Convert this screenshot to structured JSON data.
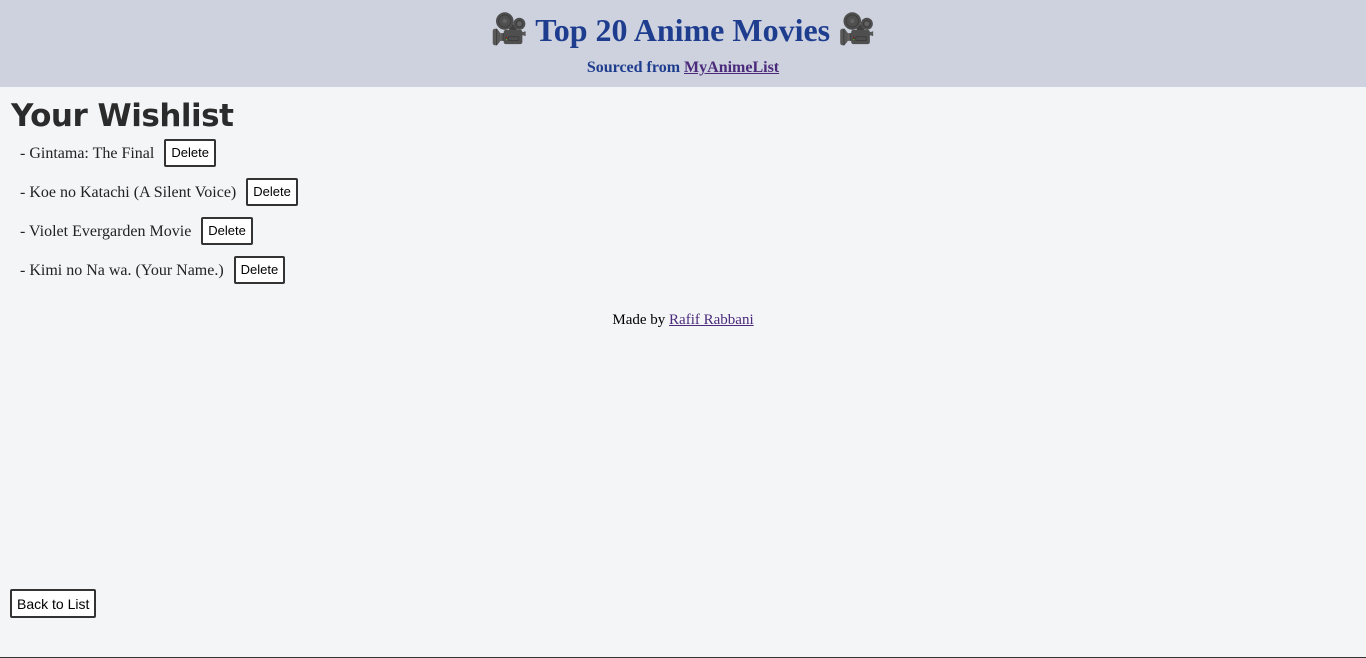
{
  "header": {
    "title": "Top 20 Anime Movies",
    "camera_glyph": "🎥",
    "subtitle_prefix": "Sourced from",
    "source_link": "MyAnimeList"
  },
  "wishlist": {
    "heading": "Your Wishlist",
    "delete_label": "Delete",
    "items": [
      {
        "title": "- Gintama: The Final"
      },
      {
        "title": "- Koe no Katachi (A Silent Voice)"
      },
      {
        "title": "- Violet Evergarden Movie"
      },
      {
        "title": "- Kimi no Na wa. (Your Name.)"
      }
    ]
  },
  "footer": {
    "credit_prefix": "Made by",
    "author": "Rafif Rabbani"
  },
  "back_button": "Back to List",
  "colors": {
    "header_bg": "#cdd2de",
    "page_bg": "#f4f5f7",
    "title": "#1f3d8f",
    "link": "#4b2a7b"
  },
  "icons": {
    "camera": "movie-camera-icon"
  }
}
